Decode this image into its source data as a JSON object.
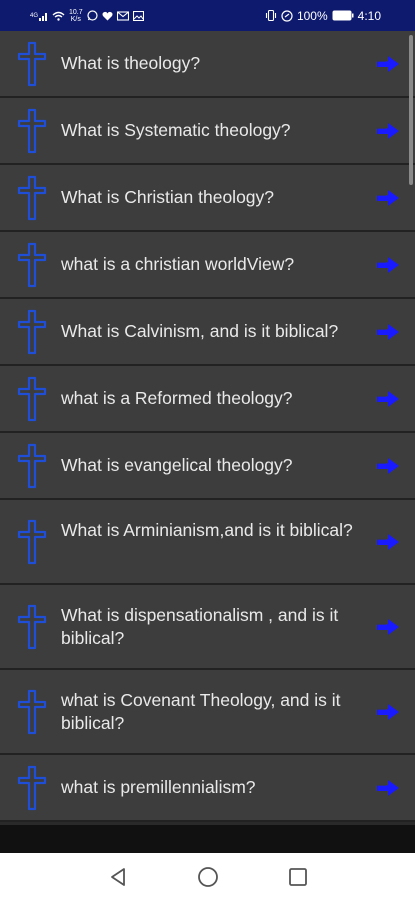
{
  "status_bar": {
    "network_speed_value": "10.7",
    "network_speed_unit": "K/s",
    "battery": "100%",
    "time": "4:10"
  },
  "questions": [
    {
      "label": "What is theology?"
    },
    {
      "label": "What is Systematic theology?"
    },
    {
      "label": "What is Christian theology?"
    },
    {
      "label": "what is a christian worldView?"
    },
    {
      "label": "What is Calvinism, and is it biblical?"
    },
    {
      "label": "what is a Reformed theology?"
    },
    {
      "label": "What is evangelical theology?"
    },
    {
      "label": "What is Arminianism,and is it biblical?"
    },
    {
      "label": "What is dispensationalism , and is it biblical?"
    },
    {
      "label": "what is Covenant Theology, and is it biblical?"
    },
    {
      "label": "what is premillennialism?"
    }
  ],
  "icons": {
    "row_icon": "cross-icon",
    "row_action": "arrow-right-icon",
    "nav": [
      "back-icon",
      "home-icon",
      "recents-icon"
    ]
  },
  "colors": {
    "accent_blue": "#1f4fd8",
    "arrow_blue": "#1a1aff",
    "row_bg": "#3d3d3d",
    "status_bar_bg": "#0d1a6e"
  }
}
